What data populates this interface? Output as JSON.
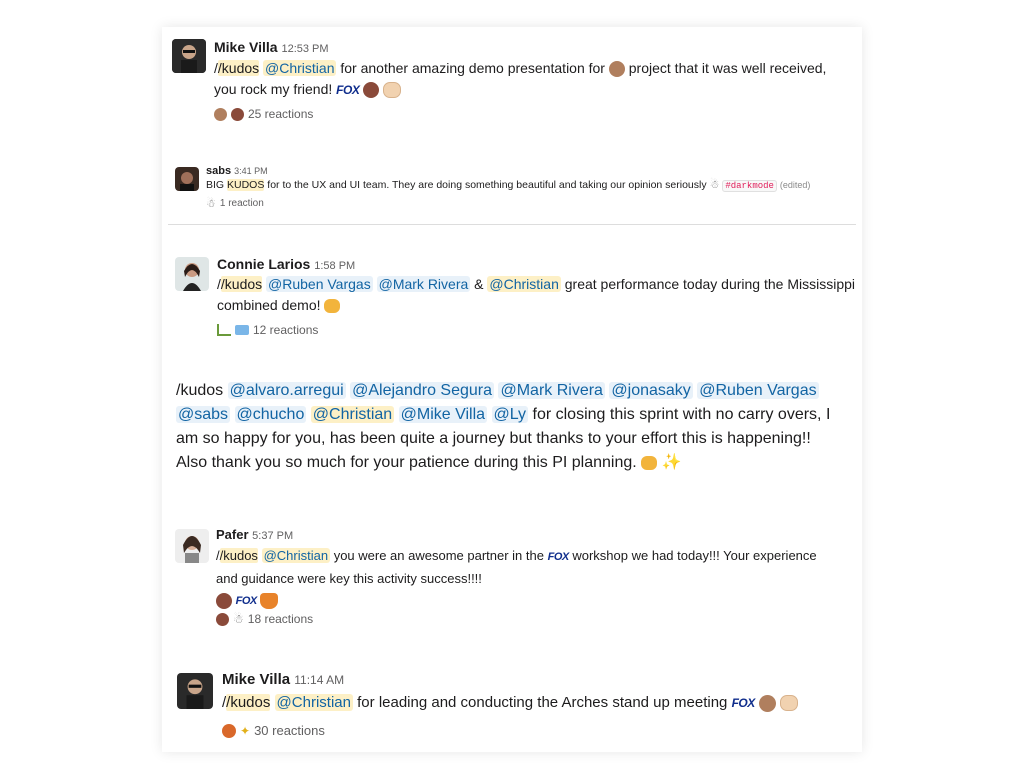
{
  "messages": [
    {
      "author": "Mike Villa",
      "time": "12:53 PM",
      "command": "/kudos",
      "mention": "@Christian",
      "text_a": "for another amazing demo presentation for",
      "text_b": "project that it was well received,",
      "text_c": "you rock my friend!",
      "fox": "FOX",
      "reactions": "25 reactions"
    },
    {
      "author": "sabs",
      "time": "3:41 PM",
      "text_a": "BIG",
      "keyword": "KUDOS",
      "text_b": "for to the UX and UI team. They are doing something beautiful and taking our opinion seriously",
      "tag": "#darkmode",
      "edited": "(edited)",
      "reactions": "1 reaction"
    },
    {
      "author": "Connie Larios",
      "time": "1:58 PM",
      "command": "/kudos",
      "mention1": "@Ruben Vargas",
      "mention2": "@Mark Rivera",
      "amp": "&",
      "mention3": "@Christian",
      "text_a": "great performance today during the Mississippi",
      "text_b": "combined demo!",
      "reactions": "12 reactions"
    },
    {
      "command": "/kudos",
      "mentions": [
        "@alvaro.arregui",
        "@Alejandro Segura",
        "@Mark Rivera",
        "@jonasaky",
        "@Ruben Vargas",
        "@sabs",
        "@chucho",
        "@Christian",
        "@Mike Villa",
        "@Ly"
      ],
      "text_a": "for closing this sprint with no carry overs, I",
      "text_b": "am so happy for you, has been quite a journey but thanks to your effort this is happening!!",
      "text_c": "Also thank you so much for your patience during this PI planning."
    },
    {
      "author": "Pafer",
      "time": "5:37 PM",
      "command": "/kudos",
      "mention": "@Christian",
      "text_a": "you were an awesome partner in the",
      "fox": "FOX",
      "text_b": "workshop we had today!!! Your experience",
      "text_c": "and guidance were key this activity success!!!!",
      "reactions": "18 reactions"
    },
    {
      "author": "Mike Villa",
      "time": "11:14 AM",
      "command": "/kudos",
      "mention": "@Christian",
      "text_a": "for leading and conducting the Arches stand up meeting",
      "fox": "FOX",
      "reactions": "30 reactions"
    }
  ],
  "colors": {
    "mention_bg": "#fdf0c6",
    "mention_text": "#1264a3",
    "link_bg": "#e8f1f9",
    "fox_blue": "#0f2d8c"
  }
}
